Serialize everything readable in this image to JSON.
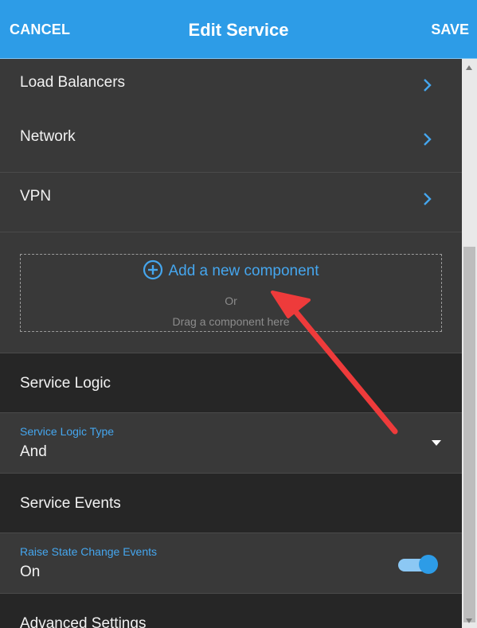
{
  "header": {
    "cancel_label": "CANCEL",
    "title": "Edit Service",
    "save_label": "SAVE",
    "color": "#2d9ce7"
  },
  "nav_items": [
    {
      "label": "Load Balancers",
      "icon": "chevron-right-icon"
    },
    {
      "label": "Network",
      "icon": "chevron-right-icon"
    },
    {
      "label": "VPN",
      "icon": "chevron-right-icon"
    }
  ],
  "drop_area": {
    "add_label": "Add a new component",
    "add_icon": "plus-circle-icon",
    "or_label": "Or",
    "drag_label": "Drag a component here"
  },
  "service_logic": {
    "section_label": "Service Logic",
    "type_label": "Service Logic Type",
    "type_value": "And"
  },
  "service_events": {
    "section_label": "Service Events",
    "field_label": "Raise State Change Events",
    "field_value": "On",
    "toggle_on": true
  },
  "advanced": {
    "section_label": "Advanced Settings"
  },
  "accent_color": "#45a6ee",
  "annotation_color": "#ee3b3b"
}
